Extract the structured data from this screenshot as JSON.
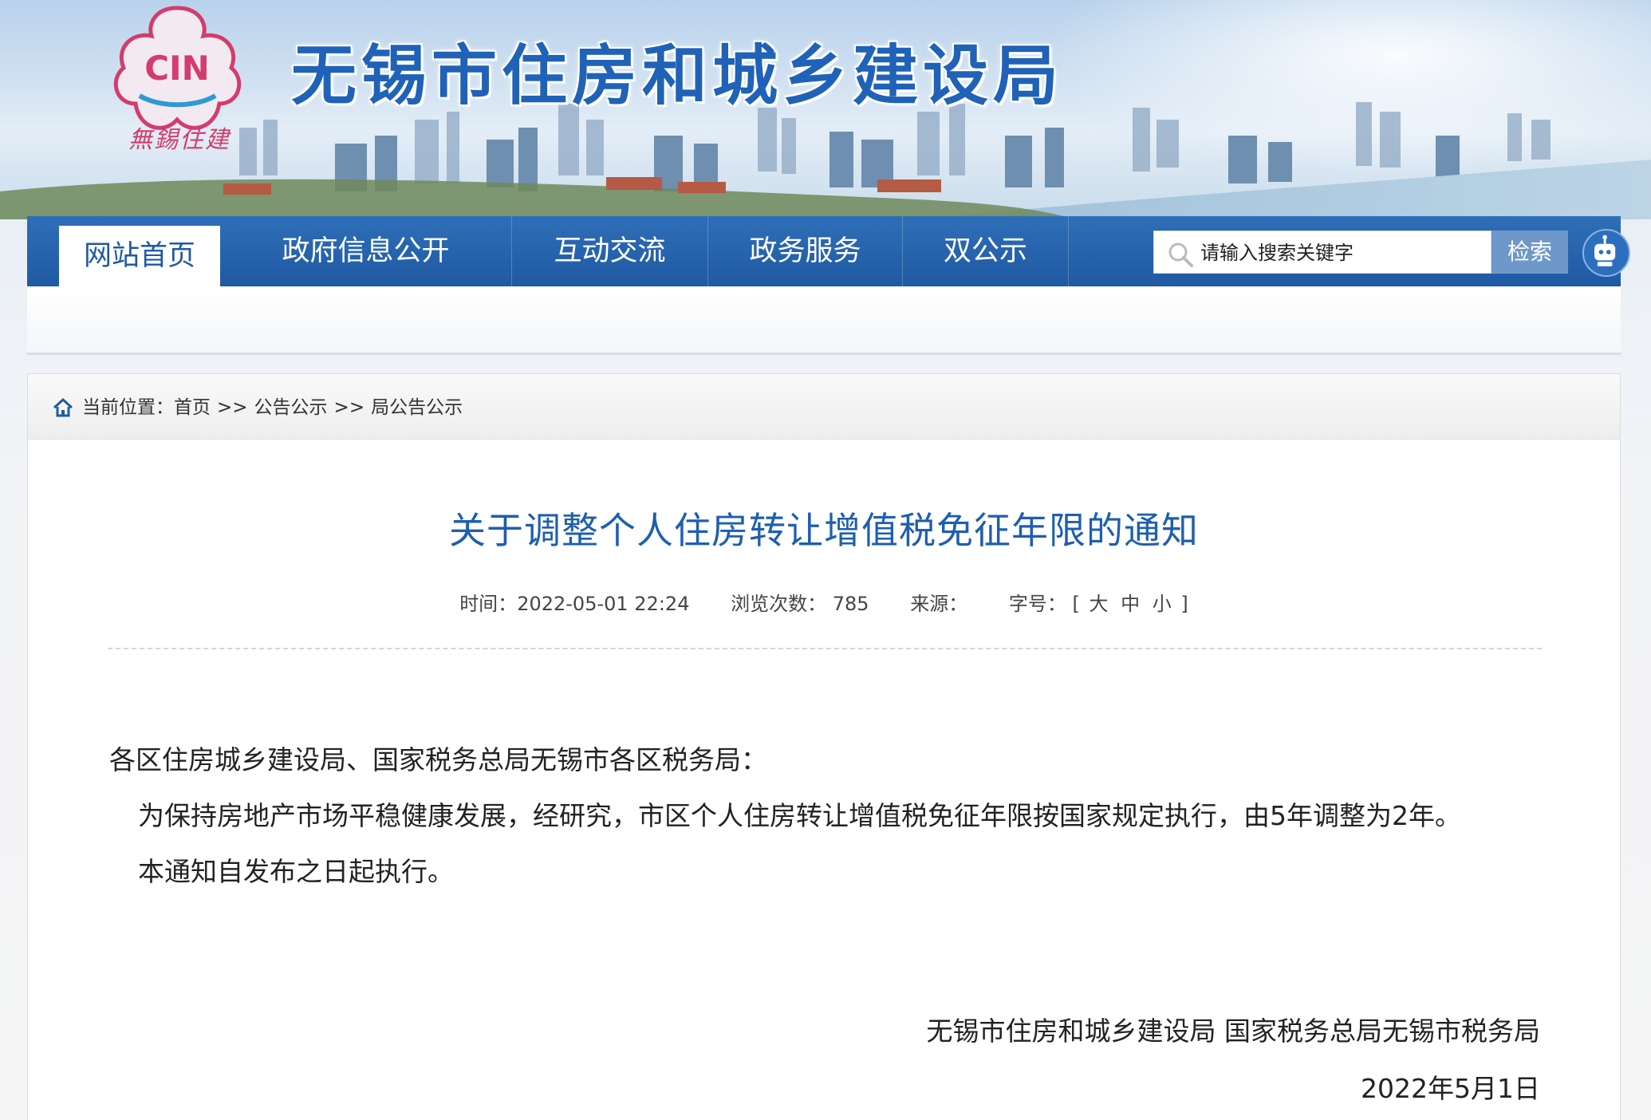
{
  "header": {
    "site_title": "无锡市住房和城乡建设局",
    "logo_text": "CIN",
    "logo_caption": "無錫住建"
  },
  "nav": {
    "items": [
      {
        "label": "网站首页",
        "active": true
      },
      {
        "label": "政府信息公开",
        "active": false
      },
      {
        "label": "互动交流",
        "active": false
      },
      {
        "label": "政务服务",
        "active": false
      },
      {
        "label": "双公示",
        "active": false
      }
    ],
    "search_placeholder": "请输入搜索关键字",
    "search_button": "检索",
    "robot_icon": "robot-icon"
  },
  "breadcrumb": {
    "prefix": "当前位置：",
    "items": [
      "首页",
      "公告公示",
      "局公告公示"
    ],
    "separator": ">>"
  },
  "article": {
    "title": "关于调整个人住房转让增值税免征年限的通知",
    "meta": {
      "time_label": "时间：",
      "time_value": "2022-05-01 22:24",
      "views_label": "浏览次数：",
      "views_value": "785",
      "source_label": "来源：",
      "source_value": "",
      "font_label": "字号：",
      "font_open": "[",
      "font_large": "大",
      "font_medium": "中",
      "font_small": "小",
      "font_close": "]"
    },
    "addressee": "各区住房城乡建设局、国家税务总局无锡市各区税务局：",
    "paragraphs": [
      "为保持房地产市场平稳健康发展，经研究，市区个人住房转让增值税免征年限按国家规定执行，由5年调整为2年。",
      "本通知自发布之日起执行。"
    ],
    "signatory": "无锡市住房和城乡建设局 国家税务总局无锡市税务局",
    "date": "2022年5月1日"
  },
  "colors": {
    "nav_bg": "#1f5aa3",
    "title_blue": "#1e5fae",
    "site_title_blue": "#1f62b8"
  }
}
